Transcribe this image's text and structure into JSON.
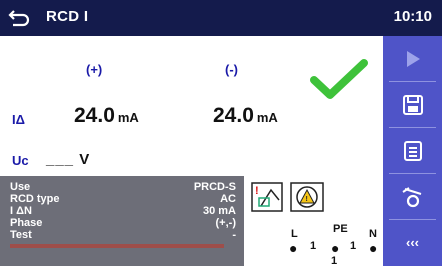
{
  "header": {
    "title": "RCD I",
    "time": "10:10"
  },
  "columns": {
    "plus": "(+)",
    "minus": "(-)"
  },
  "ia": {
    "label": "IΔ",
    "plus_value": "24.0",
    "minus_value": "24.0",
    "unit": "mA"
  },
  "uc": {
    "label": "Uc",
    "value": "___",
    "unit": "V"
  },
  "params": [
    {
      "name": "Use",
      "value": "PRCD-S"
    },
    {
      "name": "RCD type",
      "value": "AC"
    },
    {
      "name": "I ΔN",
      "value": "30 mA"
    },
    {
      "name": "Phase",
      "value": "(+,-)"
    },
    {
      "name": "Test",
      "value": "-"
    }
  ],
  "diagram": {
    "l": "L",
    "pe": "PE",
    "n": "N",
    "one": "1"
  },
  "sidebar": {
    "buttons": [
      "play-icon",
      "save-icon",
      "list-icon",
      "probe-icon",
      "more-icon"
    ],
    "more_label": "‹‹‹"
  },
  "colors": {
    "title_bg": "#141b4c",
    "sidebar_bg": "#4f54c8",
    "check": "#3ec23a",
    "label_blue": "#1a1aa8"
  }
}
